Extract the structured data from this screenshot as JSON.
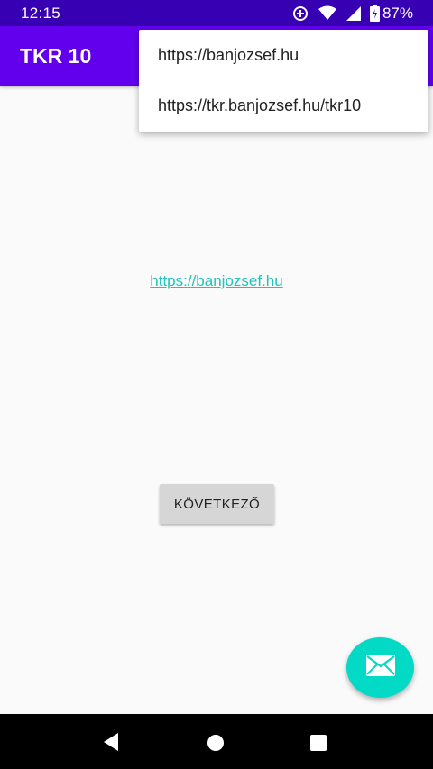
{
  "status_bar": {
    "time": "12:15",
    "battery_percent": "87%",
    "icons": [
      "data-saver-icon",
      "wifi-icon",
      "cellular-signal-icon",
      "battery-icon"
    ]
  },
  "app_bar": {
    "title": "TKR 10"
  },
  "popup_menu": {
    "items": [
      {
        "label": "https://banjozsef.hu"
      },
      {
        "label": "https://tkr.banjozsef.hu/tkr10"
      }
    ]
  },
  "main": {
    "link_text": "https://banjozsef.hu",
    "next_button_label": "KÖVETKEZŐ"
  },
  "fab": {
    "icon": "email-icon"
  },
  "nav_bar": {
    "buttons": [
      "back-icon",
      "home-icon",
      "recents-icon"
    ]
  },
  "colors": {
    "status_bar": "#3700b3",
    "app_bar": "#6200ee",
    "accent": "#03dac5",
    "link": "#1fc4bc",
    "background": "#fafafa"
  }
}
